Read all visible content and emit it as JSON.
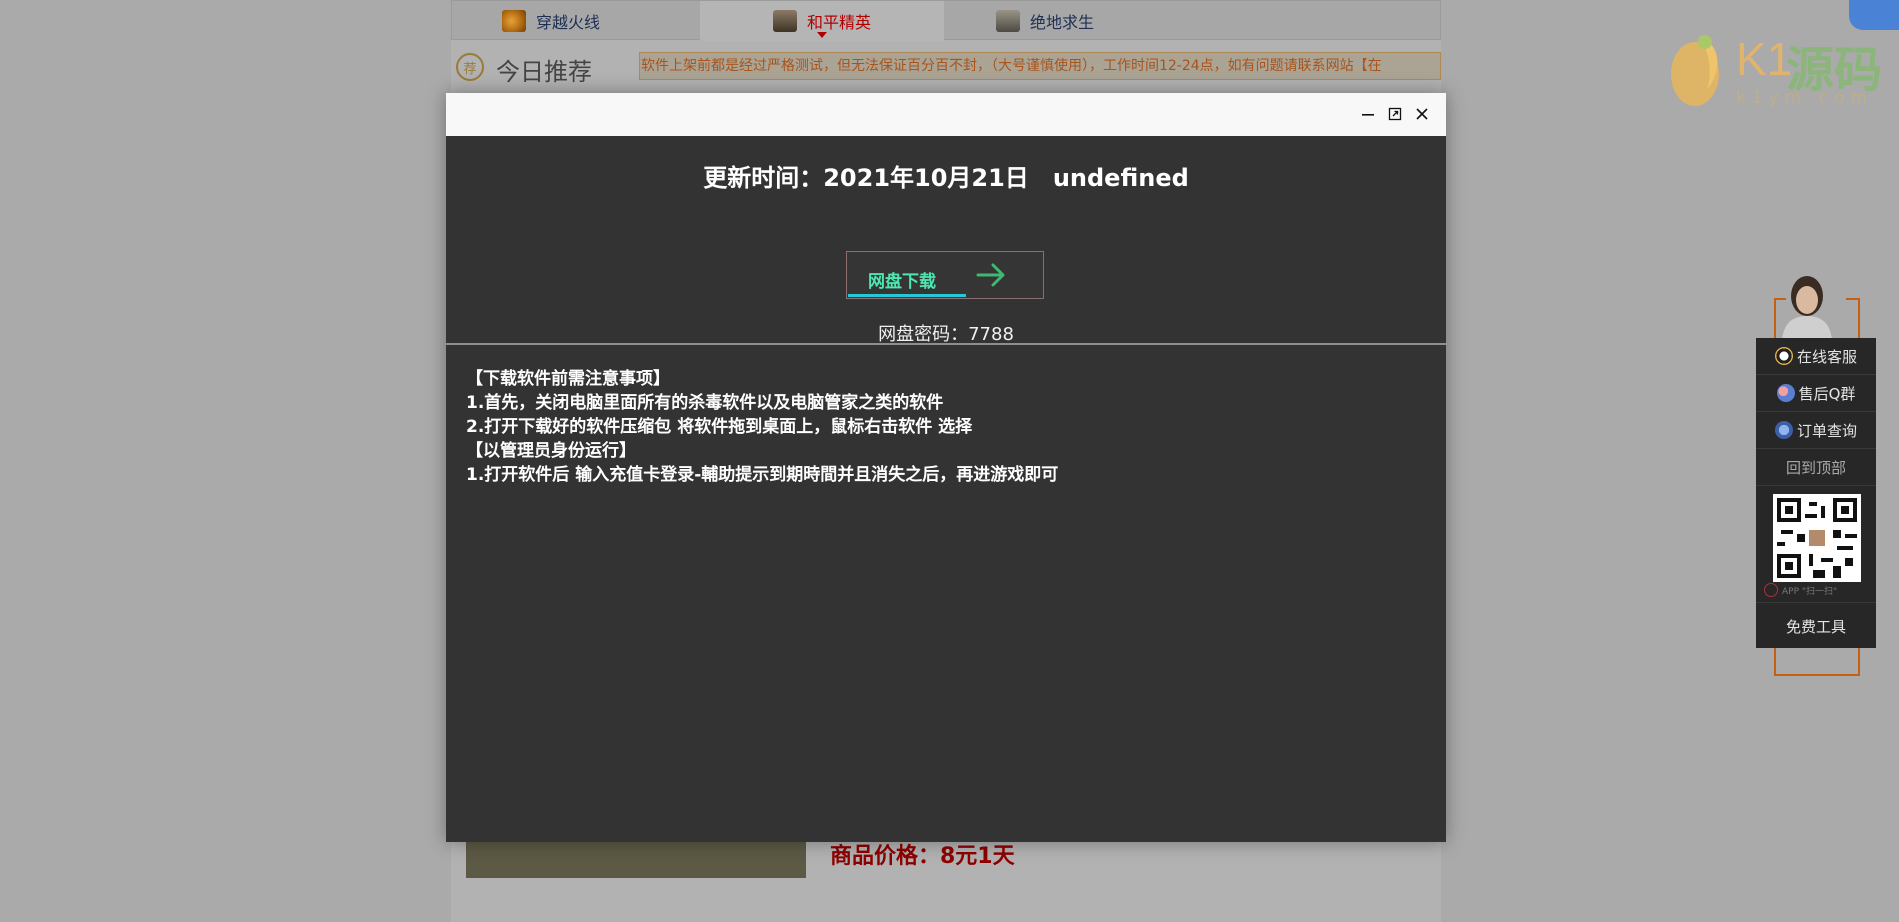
{
  "nav": {
    "tabs": [
      {
        "label": "穿越火线",
        "icon": "cf-game-icon"
      },
      {
        "label": "和平精英",
        "icon": "peace-elite-game-icon",
        "active": true
      },
      {
        "label": "绝地求生",
        "icon": "pubg-game-icon"
      }
    ]
  },
  "recommend": {
    "badge": "荐",
    "title": "今日推荐",
    "notice": "软件上架前都是经过严格测试，但无法保证百分百不封，（大号谨慎使用），工作时间12-24点，如有问题请联系网站【在"
  },
  "product": {
    "price": "商品价格：8元1天"
  },
  "logo": {
    "k": "K1",
    "cn": "源码",
    "domain": "k1ym.com"
  },
  "side_panel": {
    "items": [
      {
        "label": "在线客服",
        "icon": "qq-penguin-icon"
      },
      {
        "label": "售后Q群",
        "icon": "group-icon"
      },
      {
        "label": "订单查询",
        "icon": "order-icon"
      }
    ],
    "back_to_top": "回到顶部",
    "qr_caption": "APP \"扫一扫\"",
    "free_tools": "免费工具"
  },
  "modal": {
    "update_time": "更新时间：2021年10月21日",
    "update_extra": "undefined",
    "download_label": "网盘下载",
    "password": "网盘密码：7788",
    "notes": [
      "【下载软件前需注意事项】",
      "1.首先，关闭电脑里面所有的杀毒软件以及电脑管家之类的软件",
      "2.打开下载好的软件压缩包 将软件拖到桌面上，鼠标右击软件 选择",
      "【以管理员身份运行】",
      "1.打开软件后 输入充值卡登录-輔助提示到期時間并且消失之后，再进游戏即可"
    ]
  },
  "colors": {
    "overlay": "#aaaaaa",
    "modal_bg": "#333333",
    "download_text": "#4ee6b0",
    "arrow": "#3fb871",
    "price": "#8e0000",
    "accent_orange": "#c46014"
  }
}
